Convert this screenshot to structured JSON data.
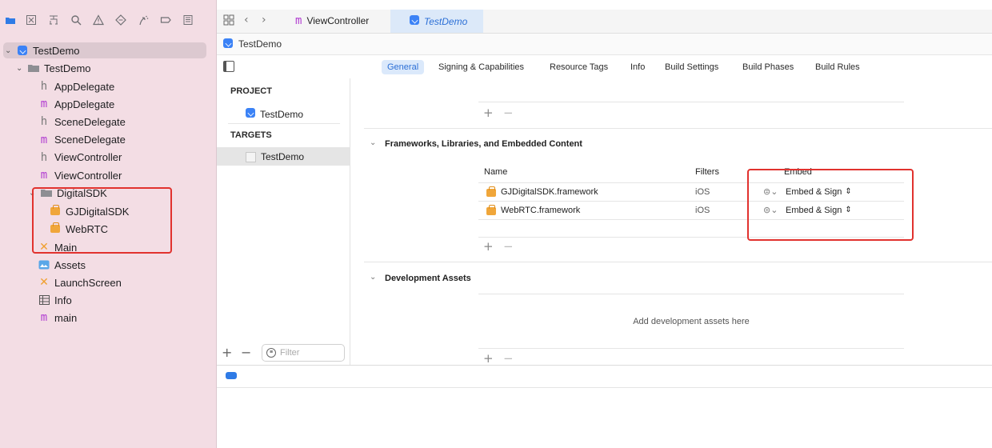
{
  "navigator": {
    "root": "TestDemo",
    "group": "TestDemo",
    "files": [
      {
        "name": "AppDelegate",
        "type": "h"
      },
      {
        "name": "AppDelegate",
        "type": "m"
      },
      {
        "name": "SceneDelegate",
        "type": "h"
      },
      {
        "name": "SceneDelegate",
        "type": "m"
      },
      {
        "name": "ViewController",
        "type": "h"
      },
      {
        "name": "ViewController",
        "type": "m"
      }
    ],
    "sdk_group": "DigitalSDK",
    "sdk_items": [
      "GJDigitalSDK",
      "WebRTC"
    ],
    "after_items": [
      {
        "name": "Main",
        "type": "storyboard"
      },
      {
        "name": "Assets",
        "type": "assets"
      },
      {
        "name": "LaunchScreen",
        "type": "storyboard"
      },
      {
        "name": "Info",
        "type": "plist"
      },
      {
        "name": "main",
        "type": "m"
      }
    ],
    "filter_placeholder": "Filter"
  },
  "tabs": {
    "file_tab": "ViewController",
    "project_tab": "TestDemo"
  },
  "breadcrumb": "TestDemo",
  "settings_tabs": [
    "General",
    "Signing & Capabilities",
    "Resource Tags",
    "Info",
    "Build Settings",
    "Build Phases",
    "Build Rules"
  ],
  "active_tab": "General",
  "targets_pane": {
    "project_header": "PROJECT",
    "project_item": "TestDemo",
    "targets_header": "TARGETS",
    "target_item": "TestDemo"
  },
  "frameworks_section": {
    "title": "Frameworks, Libraries, and Embedded Content",
    "col_name": "Name",
    "col_filters": "Filters",
    "col_embed": "Embed",
    "rows": [
      {
        "name": "GJDigitalSDK.framework",
        "filters": "iOS",
        "embed": "Embed & Sign"
      },
      {
        "name": "WebRTC.framework",
        "filters": "iOS",
        "embed": "Embed & Sign"
      }
    ]
  },
  "dev_assets_section": {
    "title": "Development Assets",
    "empty_text": "Add development assets here"
  },
  "colors": {
    "sidebar_bg": "#f3dde4",
    "accent": "#2b6fd6",
    "highlight_box": "#e1322e"
  }
}
